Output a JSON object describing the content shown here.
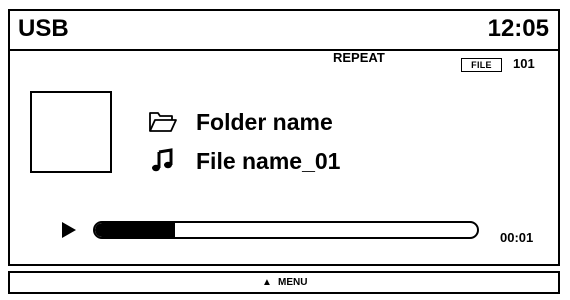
{
  "header": {
    "source": "USB",
    "time": "12:05"
  },
  "status": {
    "repeat": "REPEAT",
    "file_badge": "FILE",
    "file_number": "101"
  },
  "track": {
    "folder_icon": "folder-icon",
    "folder_name": "Folder name",
    "file_icon": "music-note-icon",
    "file_name": "File name_01"
  },
  "playback": {
    "state_icon": "play-icon",
    "progress": 0.21,
    "elapsed": "00:01"
  },
  "footer": {
    "menu_icon": "up-triangle-icon",
    "menu_label": "MENU"
  }
}
